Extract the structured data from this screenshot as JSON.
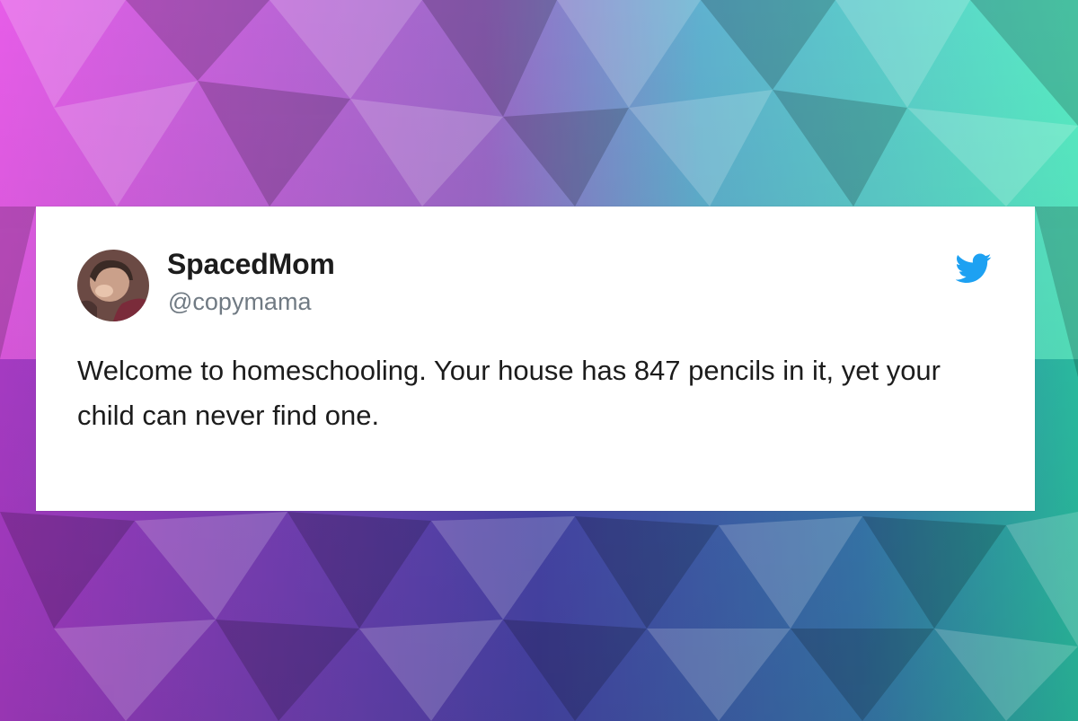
{
  "tweet": {
    "display_name": "SpacedMom",
    "handle": "@copymama",
    "text": "Welcome to homeschooling. Your house has 847 pencils in it, yet your child can never find one.",
    "platform_icon": "twitter-bird-icon"
  },
  "colors": {
    "card_background": "#ffffff",
    "text": "#1c1c1c",
    "handle": "#707a83",
    "twitter_blue": "#1da1f2"
  }
}
